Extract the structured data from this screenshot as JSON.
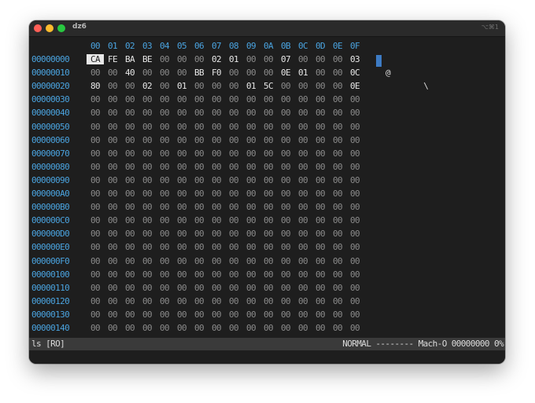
{
  "window": {
    "title": "dz6",
    "shortcut": "⌥⌘1"
  },
  "colors": {
    "address": "#4aa3df",
    "cursor": "#e8e8e8",
    "ascii_cursor": "#3d7bc4",
    "statusbar": "#3a3a3a"
  },
  "header": [
    "00",
    "01",
    "02",
    "03",
    "04",
    "05",
    "06",
    "07",
    "08",
    "09",
    "0A",
    "0B",
    "0C",
    "0D",
    "0E",
    "0F"
  ],
  "rows": [
    {
      "addr": "00000000",
      "bytes": [
        "CA",
        "FE",
        "BA",
        "BE",
        "00",
        "00",
        "00",
        "02",
        "01",
        "00",
        "00",
        "07",
        "00",
        "00",
        "00",
        "03"
      ],
      "ascii": ""
    },
    {
      "addr": "00000010",
      "bytes": [
        "00",
        "00",
        "40",
        "00",
        "00",
        "00",
        "BB",
        "F0",
        "00",
        "00",
        "00",
        "0E",
        "01",
        "00",
        "00",
        "0C"
      ],
      "ascii": "  @"
    },
    {
      "addr": "00000020",
      "bytes": [
        "80",
        "00",
        "00",
        "02",
        "00",
        "01",
        "00",
        "00",
        "00",
        "01",
        "5C",
        "00",
        "00",
        "00",
        "00",
        "0E"
      ],
      "ascii": "          \\"
    },
    {
      "addr": "00000030",
      "bytes": [
        "00",
        "00",
        "00",
        "00",
        "00",
        "00",
        "00",
        "00",
        "00",
        "00",
        "00",
        "00",
        "00",
        "00",
        "00",
        "00"
      ],
      "ascii": ""
    },
    {
      "addr": "00000040",
      "bytes": [
        "00",
        "00",
        "00",
        "00",
        "00",
        "00",
        "00",
        "00",
        "00",
        "00",
        "00",
        "00",
        "00",
        "00",
        "00",
        "00"
      ],
      "ascii": ""
    },
    {
      "addr": "00000050",
      "bytes": [
        "00",
        "00",
        "00",
        "00",
        "00",
        "00",
        "00",
        "00",
        "00",
        "00",
        "00",
        "00",
        "00",
        "00",
        "00",
        "00"
      ],
      "ascii": ""
    },
    {
      "addr": "00000060",
      "bytes": [
        "00",
        "00",
        "00",
        "00",
        "00",
        "00",
        "00",
        "00",
        "00",
        "00",
        "00",
        "00",
        "00",
        "00",
        "00",
        "00"
      ],
      "ascii": ""
    },
    {
      "addr": "00000070",
      "bytes": [
        "00",
        "00",
        "00",
        "00",
        "00",
        "00",
        "00",
        "00",
        "00",
        "00",
        "00",
        "00",
        "00",
        "00",
        "00",
        "00"
      ],
      "ascii": ""
    },
    {
      "addr": "00000080",
      "bytes": [
        "00",
        "00",
        "00",
        "00",
        "00",
        "00",
        "00",
        "00",
        "00",
        "00",
        "00",
        "00",
        "00",
        "00",
        "00",
        "00"
      ],
      "ascii": ""
    },
    {
      "addr": "00000090",
      "bytes": [
        "00",
        "00",
        "00",
        "00",
        "00",
        "00",
        "00",
        "00",
        "00",
        "00",
        "00",
        "00",
        "00",
        "00",
        "00",
        "00"
      ],
      "ascii": ""
    },
    {
      "addr": "000000A0",
      "bytes": [
        "00",
        "00",
        "00",
        "00",
        "00",
        "00",
        "00",
        "00",
        "00",
        "00",
        "00",
        "00",
        "00",
        "00",
        "00",
        "00"
      ],
      "ascii": ""
    },
    {
      "addr": "000000B0",
      "bytes": [
        "00",
        "00",
        "00",
        "00",
        "00",
        "00",
        "00",
        "00",
        "00",
        "00",
        "00",
        "00",
        "00",
        "00",
        "00",
        "00"
      ],
      "ascii": ""
    },
    {
      "addr": "000000C0",
      "bytes": [
        "00",
        "00",
        "00",
        "00",
        "00",
        "00",
        "00",
        "00",
        "00",
        "00",
        "00",
        "00",
        "00",
        "00",
        "00",
        "00"
      ],
      "ascii": ""
    },
    {
      "addr": "000000D0",
      "bytes": [
        "00",
        "00",
        "00",
        "00",
        "00",
        "00",
        "00",
        "00",
        "00",
        "00",
        "00",
        "00",
        "00",
        "00",
        "00",
        "00"
      ],
      "ascii": ""
    },
    {
      "addr": "000000E0",
      "bytes": [
        "00",
        "00",
        "00",
        "00",
        "00",
        "00",
        "00",
        "00",
        "00",
        "00",
        "00",
        "00",
        "00",
        "00",
        "00",
        "00"
      ],
      "ascii": ""
    },
    {
      "addr": "000000F0",
      "bytes": [
        "00",
        "00",
        "00",
        "00",
        "00",
        "00",
        "00",
        "00",
        "00",
        "00",
        "00",
        "00",
        "00",
        "00",
        "00",
        "00"
      ],
      "ascii": ""
    },
    {
      "addr": "00000100",
      "bytes": [
        "00",
        "00",
        "00",
        "00",
        "00",
        "00",
        "00",
        "00",
        "00",
        "00",
        "00",
        "00",
        "00",
        "00",
        "00",
        "00"
      ],
      "ascii": ""
    },
    {
      "addr": "00000110",
      "bytes": [
        "00",
        "00",
        "00",
        "00",
        "00",
        "00",
        "00",
        "00",
        "00",
        "00",
        "00",
        "00",
        "00",
        "00",
        "00",
        "00"
      ],
      "ascii": ""
    },
    {
      "addr": "00000120",
      "bytes": [
        "00",
        "00",
        "00",
        "00",
        "00",
        "00",
        "00",
        "00",
        "00",
        "00",
        "00",
        "00",
        "00",
        "00",
        "00",
        "00"
      ],
      "ascii": ""
    },
    {
      "addr": "00000130",
      "bytes": [
        "00",
        "00",
        "00",
        "00",
        "00",
        "00",
        "00",
        "00",
        "00",
        "00",
        "00",
        "00",
        "00",
        "00",
        "00",
        "00"
      ],
      "ascii": ""
    },
    {
      "addr": "00000140",
      "bytes": [
        "00",
        "00",
        "00",
        "00",
        "00",
        "00",
        "00",
        "00",
        "00",
        "00",
        "00",
        "00",
        "00",
        "00",
        "00",
        "00"
      ],
      "ascii": ""
    }
  ],
  "status": {
    "left": "ls [RO]",
    "right": "NORMAL -------- Mach-O 00000000 0%"
  }
}
